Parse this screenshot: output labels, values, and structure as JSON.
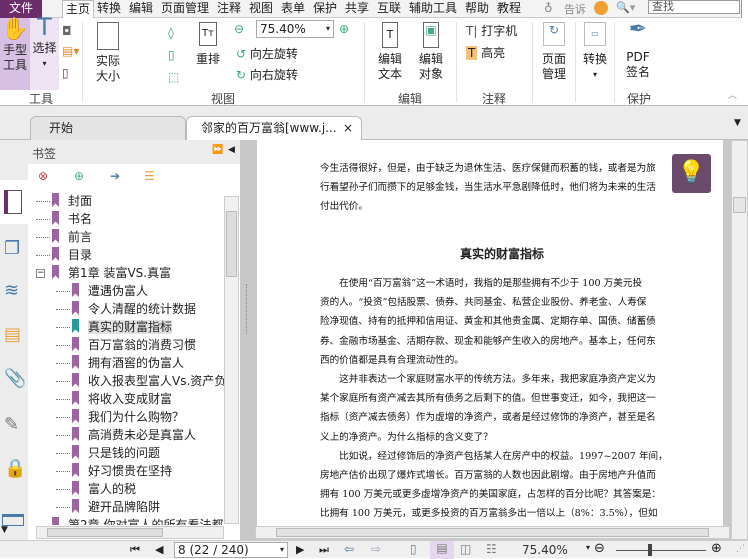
{
  "menu": {
    "file": "文件",
    "tabs": [
      "主页",
      "转换",
      "编辑",
      "页面管理",
      "注释",
      "视图",
      "表单",
      "保护",
      "共享",
      "互联",
      "辅助工具",
      "帮助",
      "教程"
    ],
    "tell_me": "告诉",
    "search_placeholder": "查找"
  },
  "ribbon": {
    "tools": {
      "hand": "手型\n工具",
      "select": "选择",
      "group": "工具"
    },
    "view": {
      "actual_size": "实际\n大小",
      "reflow": "重排",
      "zoom_value": "75.40%",
      "rotate_left": "向左旋转",
      "rotate_right": "向右旋转",
      "group": "视图"
    },
    "edit": {
      "edit_text": "编辑\n文本",
      "edit_object": "编辑\n对象",
      "group": "编辑"
    },
    "comment": {
      "typewriter": "打字机",
      "highlight": "高亮",
      "group": "注释"
    },
    "page_manage": {
      "label": "页面\n管理"
    },
    "convert": {
      "label": "转换"
    },
    "protect": {
      "pdf_sign": "PDF\n签名",
      "group": "保护"
    }
  },
  "doc_tabs": [
    "开始",
    "邻家的百万富翁[www.j..."
  ],
  "sidebar": {
    "title": "书签",
    "bookmarks": [
      {
        "label": "封面",
        "level": 0
      },
      {
        "label": "书名",
        "level": 0
      },
      {
        "label": "前言",
        "level": 0
      },
      {
        "label": "目录",
        "level": 0
      },
      {
        "label": "第1章 装富VS.真富",
        "level": 0,
        "expanded": true
      },
      {
        "label": "遭遇伪富人",
        "level": 1
      },
      {
        "label": "令人清醒的统计数据",
        "level": 1
      },
      {
        "label": "真实的财富指标",
        "level": 1,
        "selected": true
      },
      {
        "label": "百万富翁的消费习惯",
        "level": 1
      },
      {
        "label": "拥有酒窖的伪富人",
        "level": 1
      },
      {
        "label": "收入报表型富人Vs.资产负",
        "level": 1
      },
      {
        "label": "将收入变成财富",
        "level": 1
      },
      {
        "label": "我们为什么购物？",
        "level": 1
      },
      {
        "label": "高消费未必是真富人",
        "level": 1
      },
      {
        "label": "只是钱的问题",
        "level": 1
      },
      {
        "label": "好习惯贵在坚持",
        "level": 1
      },
      {
        "label": "富人的税",
        "level": 1
      },
      {
        "label": "避开品牌陷阱",
        "level": 1
      },
      {
        "label": "第2章 你对富人的所有看法都",
        "level": 0
      }
    ]
  },
  "document": {
    "lines_top": [
      "今生活得很好，但是，由于缺乏为退休生活、医疗保健而积蓄的钱，或者是为旅",
      "行看望孙子们而攒下的足够金钱，当生活水平急剧降低时，他们将为未来的生活",
      "付出代价。"
    ],
    "heading": "真实的财富指标",
    "lines": [
      "　　在使用“百万富翁”这一术语时，我指的是那些拥有不少于 100 万美元投",
      "资的人。“投资”包括股票、债券、共同基金、私营企业股份、养老金、人寿保",
      "险净现值、持有的抵押和信用证、黄金和其他贵金属、定期存单、国债、储蓄债",
      "券、金融市场基金、活期存款、现金和能够产生收入的房地产。基本上，任何东",
      "西的价值都是具有合理流动性的。",
      "　　这并非表达一个家庭财富水平的传统方法。多年来，我把家庭净资产定义为",
      "某个家庭所有资产减去其所有债务之后剩下的值。但世事变迁，如今，我把这一",
      "指标（资产减去债务）作为虚增的净资产，或者是经过修饰的净资产，甚至是名",
      "义上的净资产。为什么指标的含义变了？",
      "　　比如说，经过修饰后的净资产包括某人在房产中的权益。1997~2007 年间，",
      "房地产估价出现了爆炸式增长。百万富翁的人数也因此剧增。由于房地产升值而",
      "拥有 100 万美元或更多虚增净资产的美国家庭，占怎样的百分比呢？其答案是：",
      "比拥有 100 万美元，或更多投资的百万富翁多出一倍以上（8%：3.5%），但如"
    ]
  },
  "status": {
    "page_field": "8 (22 / 240)",
    "zoom": "75.40%"
  },
  "colors": {
    "brand": "#6b2d6b",
    "bookmark": "#9b66a0",
    "bookmark_selected": "#2a9a96",
    "accent_light": "#e6d7ee"
  }
}
